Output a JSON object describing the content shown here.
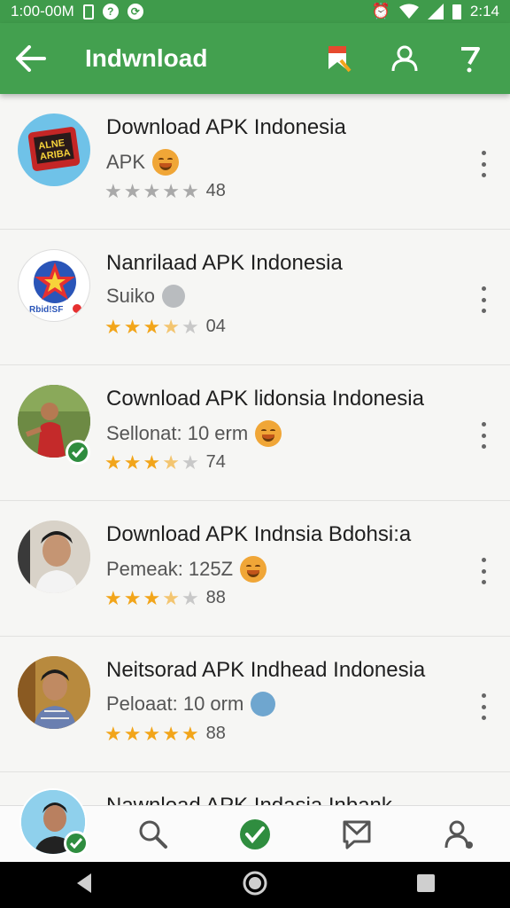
{
  "status_bar": {
    "time_left": "1:00-00M",
    "time_right": "2:14"
  },
  "app_bar": {
    "title": "Indwnload"
  },
  "items": [
    {
      "name": "Download APK Indonesia",
      "subtitle": "APK",
      "rating": 48,
      "stars_on": 0,
      "star_style": "grey",
      "verified": false,
      "emoji": "smile"
    },
    {
      "name": "Nanrilaad APK Indonesia",
      "subtitle": "Suiko",
      "rating": "04",
      "stars_on": 3,
      "star_style": "gold",
      "verified": false,
      "emoji": "grey"
    },
    {
      "name": "Cownload APK lidonsia Indonesia",
      "subtitle": "Sellonat:  10 erm",
      "rating": 74,
      "stars_on": 3,
      "star_style": "gold",
      "verified": true,
      "emoji": "smile"
    },
    {
      "name": "Download APK Indnsia Bdohsi:a",
      "subtitle": "Pemeak:  125Z",
      "rating": 88,
      "stars_on": 3,
      "star_style": "gold",
      "verified": false,
      "emoji": "smile"
    },
    {
      "name": "Neitsorad APK Indhead Indonesia",
      "subtitle": "Peloaat:  10 orm",
      "rating": 88,
      "stars_on": 5,
      "star_style": "gold",
      "verified": false,
      "emoji": "blue"
    },
    {
      "name": "Nawnload APK Indasia Inbank",
      "subtitle": "",
      "rating": "",
      "stars_on": 0,
      "star_style": "none",
      "verified": false,
      "emoji": "none"
    }
  ],
  "icons": {
    "back": "arrow-left-icon",
    "bookmark": "bookmark-icon",
    "account": "account-icon",
    "help": "help-icon"
  },
  "colors": {
    "app_bar": "#43a04f",
    "status_bar": "#3f9b4b",
    "star": "#f2a51a",
    "verified": "#2f8d3f"
  }
}
